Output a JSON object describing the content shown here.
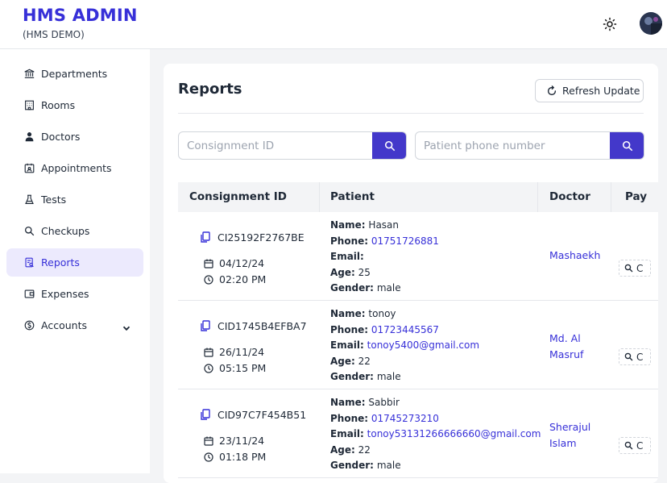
{
  "header": {
    "title": "HMS ADMIN",
    "subtitle": "(HMS DEMO)",
    "theme_icon": "sun-icon",
    "avatar": "user-avatar"
  },
  "sidebar": {
    "items": [
      {
        "label": "Departments",
        "icon": "bank-icon"
      },
      {
        "label": "Rooms",
        "icon": "building-icon"
      },
      {
        "label": "Doctors",
        "icon": "doctor-icon"
      },
      {
        "label": "Appointments",
        "icon": "calendar-user-icon"
      },
      {
        "label": "Tests",
        "icon": "flask-icon"
      },
      {
        "label": "Checkups",
        "icon": "search-icon"
      },
      {
        "label": "Reports",
        "icon": "report-icon",
        "active": true
      },
      {
        "label": "Expenses",
        "icon": "wallet-icon"
      },
      {
        "label": "Accounts",
        "icon": "dollar-circle-icon",
        "has_dropdown": true
      }
    ]
  },
  "main": {
    "title": "Reports",
    "refresh_label": "Refresh Update",
    "search_consignment": {
      "placeholder": "Consignment ID"
    },
    "search_phone": {
      "placeholder": "Patient phone number"
    },
    "table": {
      "columns": [
        "Consignment ID",
        "Patient",
        "Doctor",
        "Pay"
      ],
      "patient_field_labels": {
        "name": "Name:",
        "phone": "Phone:",
        "email": "Email:",
        "age": "Age:",
        "gender": "Gender:"
      },
      "rows": [
        {
          "consignment_id": "CI25192F2767BE",
          "date": "04/12/24",
          "time": "02:20 PM",
          "name": "Hasan",
          "phone": "01751726881",
          "email": "",
          "age": "25",
          "gender": "male",
          "doctor": "Mashaekh",
          "pay_glyph": "C"
        },
        {
          "consignment_id": "CID1745B4EFBA7",
          "date": "26/11/24",
          "time": "05:15 PM",
          "name": "tonoy",
          "phone": "01723445567",
          "email": "tonoy5400@gmail.com",
          "age": "22",
          "gender": "male",
          "doctor": "Md. Al Masruf",
          "pay_glyph": "C"
        },
        {
          "consignment_id": "CID97C7F454B51",
          "date": "23/11/24",
          "time": "01:18 PM",
          "name": "Sabbir",
          "phone": "01745273210",
          "email": "tonoy53131266666660@gmail.com",
          "age": "22",
          "gender": "male",
          "doctor": "Sherajul Islam",
          "pay_glyph": "C"
        }
      ]
    }
  },
  "colors": {
    "brand": "#3730d8",
    "search_button": "#4338ca",
    "active_bg": "#eceafd"
  }
}
